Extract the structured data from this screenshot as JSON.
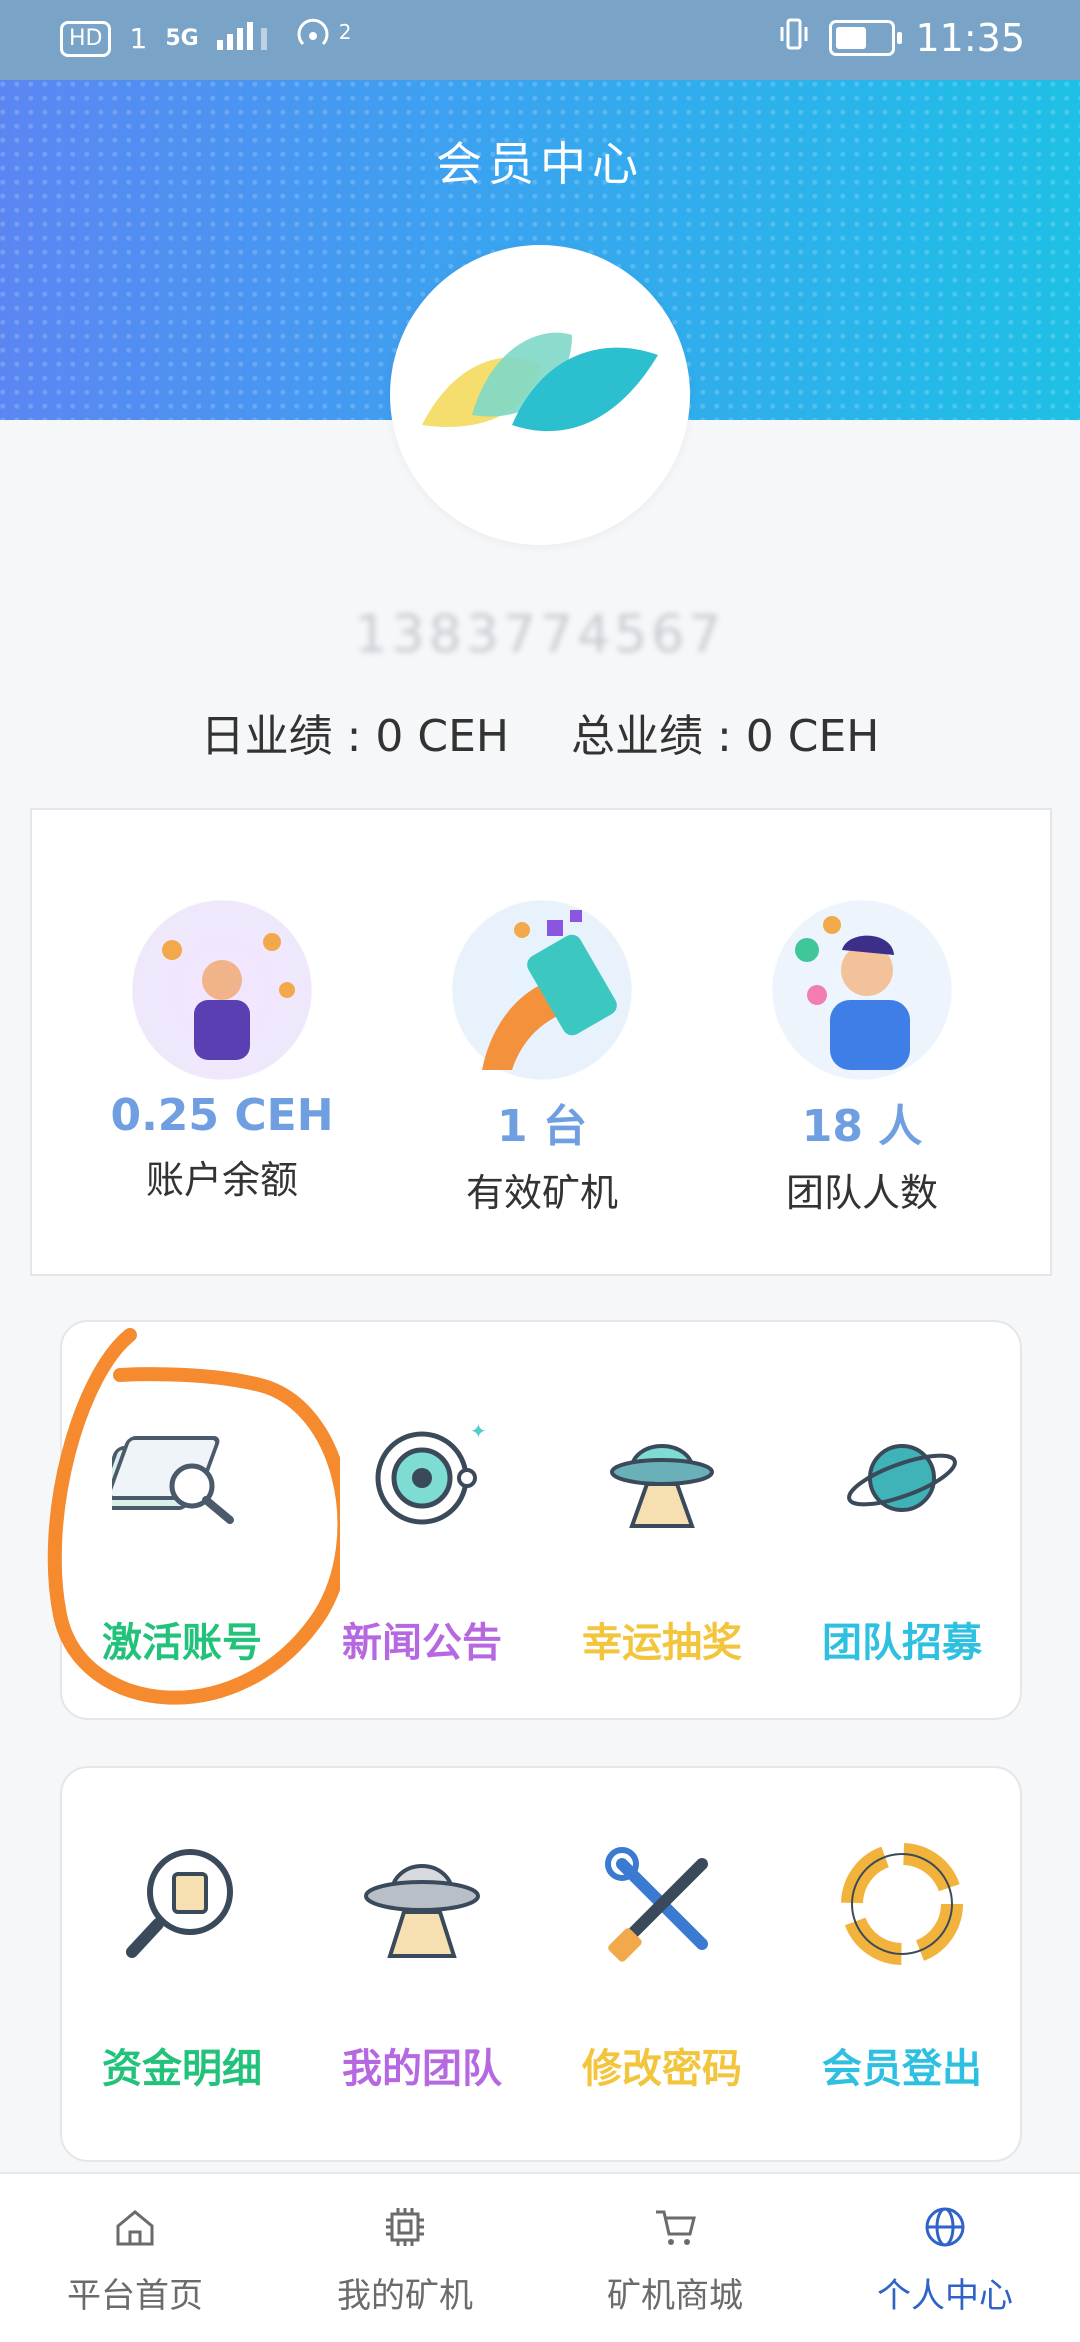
{
  "status_bar": {
    "hd": "HD",
    "sim": "1",
    "network": "5G",
    "hotspot_count": "2",
    "time": "11:35"
  },
  "header": {
    "title": "会员中心"
  },
  "user": {
    "phone_masked": "1383774567",
    "daily_perf_label": "日业绩 : 0 CEH",
    "total_perf_label": "总业绩 : 0 CEH"
  },
  "stats": [
    {
      "value": "0.25 CEH",
      "label": "账户余额"
    },
    {
      "value": "1 台",
      "label": "有效矿机"
    },
    {
      "value": "18 人",
      "label": "团队人数"
    }
  ],
  "grid1": [
    {
      "label": "激活账号",
      "color": "#22c27a",
      "icon": "document-search-icon"
    },
    {
      "label": "新闻公告",
      "color": "#b568e0",
      "icon": "orbit-icon"
    },
    {
      "label": "幸运抽奖",
      "color": "#f2c53d",
      "icon": "ufo-icon"
    },
    {
      "label": "团队招募",
      "color": "#2ec0e0",
      "icon": "planet-icon"
    }
  ],
  "grid2": [
    {
      "label": "资金明细",
      "color": "#22c27a",
      "icon": "magnifier-icon"
    },
    {
      "label": "我的团队",
      "color": "#b568e0",
      "icon": "ufo-icon"
    },
    {
      "label": "修改密码",
      "color": "#f2c53d",
      "icon": "tools-icon"
    },
    {
      "label": "会员登出",
      "color": "#2ec0e0",
      "icon": "lifebuoy-icon"
    }
  ],
  "tabs": [
    {
      "label": "平台首页",
      "icon": "home-icon",
      "active": false
    },
    {
      "label": "我的矿机",
      "icon": "chip-icon",
      "active": false
    },
    {
      "label": "矿机商城",
      "icon": "cart-icon",
      "active": false
    },
    {
      "label": "个人中心",
      "icon": "globe-icon",
      "active": true
    }
  ],
  "colors": {
    "active_tab": "#2f63c8",
    "stat_value": "#6f9fe0",
    "annotation": "#f58a2e"
  }
}
